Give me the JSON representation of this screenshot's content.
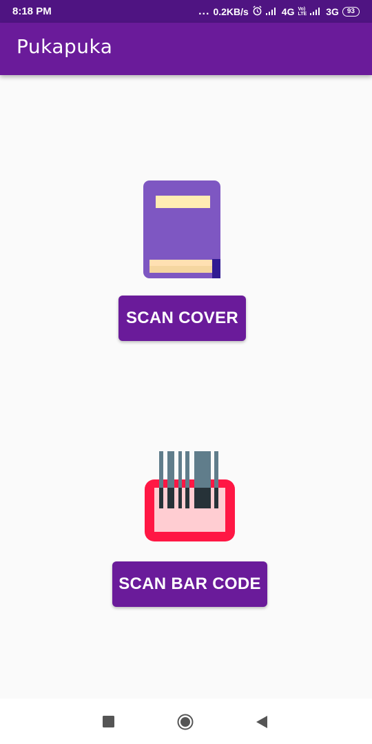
{
  "status_bar": {
    "time": "8:18 PM",
    "dots": "...",
    "network_speed": "0.2KB/s",
    "net1": "4G",
    "volte_top": "Vo)",
    "volte_bottom": "LTE",
    "net2": "3G",
    "battery": "93",
    "icons": [
      "alarm-icon",
      "signal-icon",
      "signal-icon-2"
    ]
  },
  "app_bar": {
    "title": "Pukapuka"
  },
  "main": {
    "scan_cover": {
      "label": "SCAN COVER",
      "icon": "book-icon"
    },
    "scan_barcode": {
      "label": "SCAN BAR CODE",
      "icon": "barcode-scanner-icon"
    }
  },
  "nav_bar": {
    "buttons": [
      "recent-apps-icon",
      "home-icon",
      "back-icon"
    ]
  },
  "colors": {
    "primary": "#6a1b9a",
    "status_bar": "#4f1482",
    "background": "#fafafa",
    "book": "#7e57c2",
    "scanner_frame": "#ff1744"
  }
}
